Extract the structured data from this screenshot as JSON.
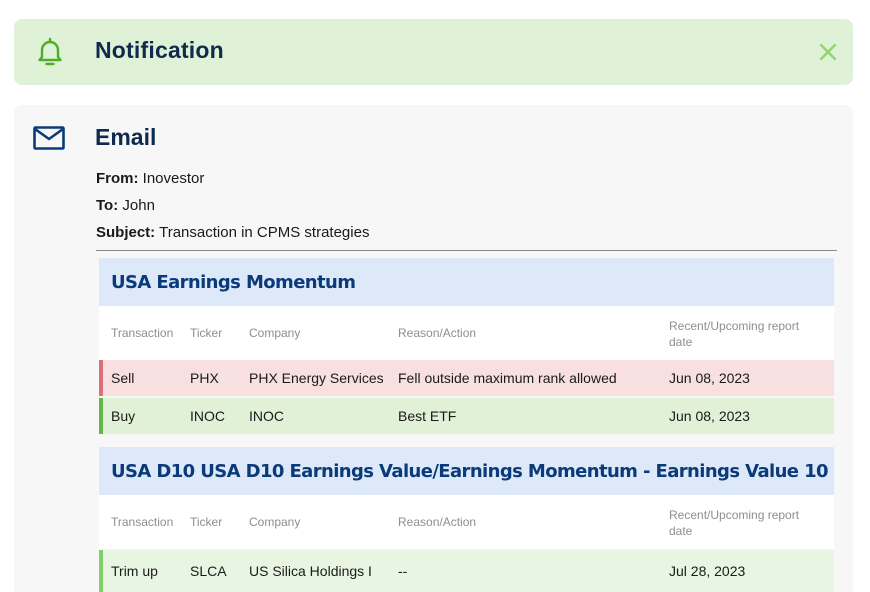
{
  "notification": {
    "title": "Notification",
    "icon": "bell-icon",
    "close_icon": "close-icon",
    "accent": "#4caf2a"
  },
  "email": {
    "title": "Email",
    "icon": "mail-icon",
    "from_label": "From:",
    "from_value": "Inovestor",
    "to_label": "To:",
    "to_value": "John",
    "subject_label": "Subject:",
    "subject_value": "Transaction in CPMS strategies"
  },
  "columns": [
    "Transaction",
    "Ticker",
    "Company",
    "Reason/Action",
    "Recent/Upcoming report date"
  ],
  "strategies": [
    {
      "name": "USA Earnings Momentum",
      "rows": [
        {
          "transaction": "Sell",
          "ticker": "PHX",
          "company": "PHX Energy Services",
          "reason": "Fell outside maximum rank allowed",
          "date": "Jun 08, 2023",
          "kind": "sell"
        },
        {
          "transaction": "Buy",
          "ticker": "INOC",
          "company": "INOC",
          "reason": "Best ETF",
          "date": "Jun 08, 2023",
          "kind": "buy"
        }
      ]
    },
    {
      "name": "USA D10 USA D10 Earnings Value/Earnings Momentum - Earnings Value 10",
      "rows": [
        {
          "transaction": "Trim up",
          "ticker": "SLCA",
          "company": "US Silica Holdings I",
          "reason": "--",
          "date": "Jul 28, 2023",
          "kind": "trim"
        }
      ]
    }
  ],
  "colors": {
    "notification_bg": "#dff1d6",
    "heading": "#0f2a4d",
    "strategy_bg": "#dde9f9",
    "strategy_text": "#0b3a7a",
    "sell_bg": "#f9e0e0",
    "buy_bg": "#e0f1d8"
  }
}
